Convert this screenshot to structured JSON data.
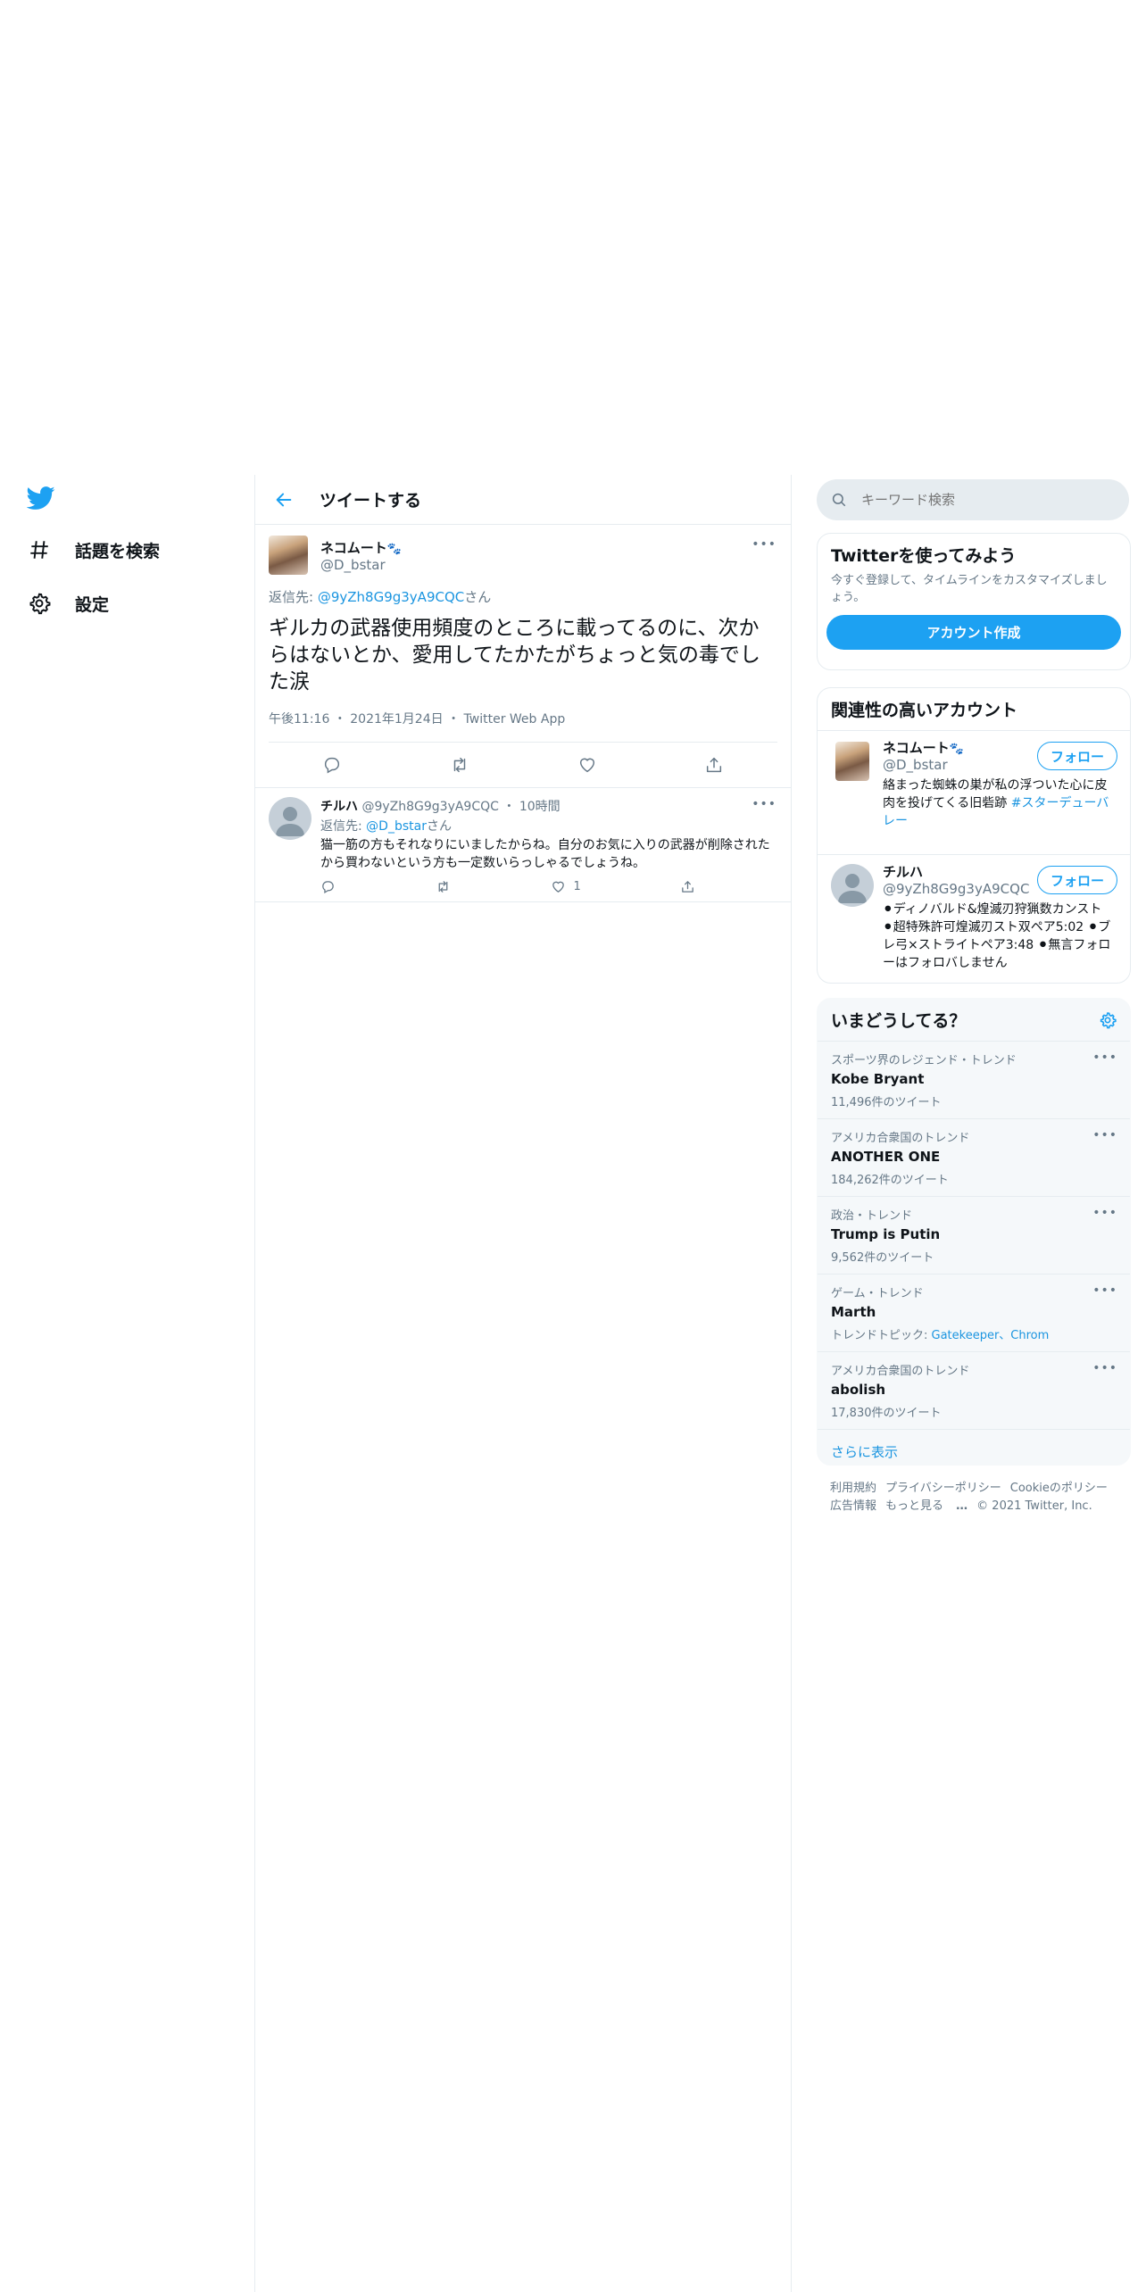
{
  "colors": {
    "accent": "#1da1f2",
    "link": "#1b95e0",
    "border": "#e6ecf0",
    "secondary_text": "#657786"
  },
  "nav": {
    "logo_icon": "twitter-bird-icon",
    "items": [
      {
        "label": "話題を検索",
        "icon": "hashtag-icon"
      },
      {
        "label": "設定",
        "icon": "gear-icon"
      }
    ]
  },
  "header": {
    "title": "ツイートする",
    "back_icon": "arrow-left-icon"
  },
  "main_tweet": {
    "name": "ネコムート",
    "name_emoji": "🐾",
    "handle": "@D_bstar",
    "reply_prefix": "返信先: ",
    "reply_to": "@9yZh8G9g3yA9CQC",
    "reply_suffix": "さん",
    "text": "ギルカの武器使用頻度のところに載ってるのに、次からはないとか、愛用してたかたがちょっと気の毒でした涙",
    "time": "午後11:16",
    "date": "2021年1月24日",
    "source": "Twitter Web App",
    "more": "•••"
  },
  "reply_tweet": {
    "name": "チルハ",
    "handle": "@9yZh8G9g3yA9CQC",
    "age": "10時間",
    "reply_prefix": "返信先: ",
    "reply_to": "@D_bstar",
    "reply_suffix": "さん",
    "text": "猫一筋の方もそれなりにいましたからね。自分のお気に入りの武器が削除されたから買わないという方も一定数いらっしゃるでしょうね。",
    "like_count": "1",
    "more": "•••"
  },
  "search": {
    "placeholder": "キーワード検索"
  },
  "signup": {
    "title": "Twitterを使ってみよう",
    "desc": "今すぐ登録して、タイムラインをカスタマイズしましょう。",
    "button": "アカウント作成"
  },
  "related": {
    "title": "関連性の高いアカウント",
    "follow_label": "フォロー",
    "accounts": [
      {
        "name": "ネコムート",
        "name_emoji": "🐾",
        "handle": "@D_bstar",
        "bio": "絡まった蜘蛛の巣が私の浮ついた心に皮肉を投げてくる旧砦跡",
        "tag": "#スターデューバレー"
      },
      {
        "name": "チルハ",
        "handle": "@9yZh8G9g3yA9CQC",
        "bio": "⚫ディノバルド&煌滅刃狩猟数カンスト ⚫超特殊許可煌滅刃スト双ペア5:02 ⚫ブレ弓×ストライトペア3:48 ⚫無言フォローはフォロバしません"
      }
    ]
  },
  "trends": {
    "title": "いまどうしてる？",
    "items": [
      {
        "context": "スポーツ界のレジェンド・トレンド",
        "name": "Kobe Bryant",
        "count": "11,496件のツイート"
      },
      {
        "context": "アメリカ合衆国のトレンド",
        "name": "ANOTHER ONE",
        "count": "184,262件のツイート"
      },
      {
        "context": "政治・トレンド",
        "name": "Trump is Putin",
        "count": "9,562件のツイート"
      },
      {
        "context": "ゲーム・トレンド",
        "name": "Marth",
        "topic_prefix": "トレンドトピック: ",
        "topics": "Gatekeeper、Chrom"
      },
      {
        "context": "アメリカ合衆国のトレンド",
        "name": "abolish",
        "count": "17,830件のツイート"
      }
    ],
    "show_more": "さらに表示"
  },
  "footer": {
    "links": [
      "利用規約",
      "プライバシーポリシー",
      "Cookieのポリシー",
      "広告情報",
      "もっと見る"
    ],
    "copyright": "© 2021 Twitter, Inc."
  }
}
